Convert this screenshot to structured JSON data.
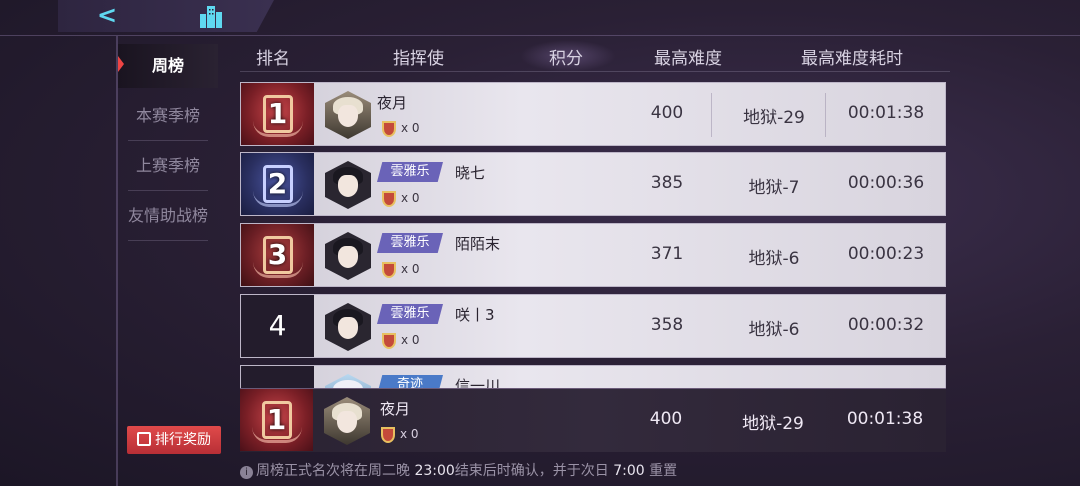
{
  "top_nav": {
    "back_icon": "back-arrow-icon",
    "city_icon": "city-buildings-icon"
  },
  "sidebar": {
    "items": [
      {
        "label": "周榜",
        "active": true
      },
      {
        "label": "本赛季榜",
        "active": false
      },
      {
        "label": "上赛季榜",
        "active": false
      },
      {
        "label": "友情助战榜",
        "active": false
      }
    ],
    "reward_button": "排行奖励"
  },
  "table": {
    "headers": {
      "rank": "排名",
      "commander": "指挥使",
      "score": "积分",
      "max_difficulty": "最高难度",
      "max_difficulty_time": "最高难度耗时"
    },
    "rows": [
      {
        "rank": "1",
        "name": "夜月",
        "tag": "",
        "medals": "x 0",
        "score": "400",
        "difficulty": "地狱-29",
        "time": "00:01:38"
      },
      {
        "rank": "2",
        "name": "晓七",
        "tag": "雲雅乐",
        "medals": "x 0",
        "score": "385",
        "difficulty": "地狱-7",
        "time": "00:00:36"
      },
      {
        "rank": "3",
        "name": "陌陌末",
        "tag": "雲雅乐",
        "medals": "x 0",
        "score": "371",
        "difficulty": "地狱-6",
        "time": "00:00:23"
      },
      {
        "rank": "4",
        "name": "咲丨3",
        "tag": "雲雅乐",
        "medals": "x 0",
        "score": "358",
        "difficulty": "地狱-6",
        "time": "00:00:32"
      },
      {
        "rank": "",
        "name": "信一川",
        "tag": "奇迹",
        "medals": "",
        "score": "",
        "difficulty": "",
        "time": ""
      }
    ],
    "self_row": {
      "rank": "1",
      "name": "夜月",
      "medals": "x 0",
      "score": "400",
      "difficulty": "地狱-29",
      "time": "00:01:38"
    }
  },
  "footer": {
    "part1": "周榜正式名次将在周二晚",
    "time1": "23:00",
    "part2": "结束后时确认，并于次日",
    "time2": "7:00",
    "part3": "重置"
  },
  "colors": {
    "accent_red": "#e04a4a",
    "tag_purple": "#6a63b8",
    "back_cyan": "#5fd8f0"
  }
}
